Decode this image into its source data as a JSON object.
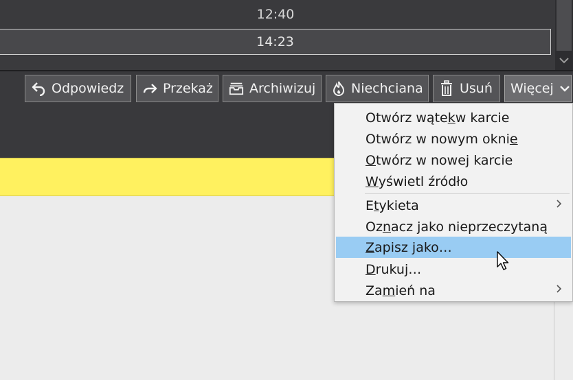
{
  "message_list": {
    "rows": [
      {
        "time": "12:40"
      },
      {
        "time": "14:23"
      }
    ]
  },
  "toolbar": {
    "reply": "Odpowiedz",
    "forward": "Przekaż",
    "archive": "Archiwizuj",
    "junk": "Niechciana",
    "delete": "Usuń",
    "more": "Więcej"
  },
  "menu": {
    "items": [
      {
        "pre": "Otwórz wąte",
        "key": "k",
        "post": " w karcie"
      },
      {
        "pre": "Otwórz w nowym okni",
        "key": "e",
        "post": ""
      },
      {
        "pre": "",
        "key": "O",
        "post": "twórz w nowej karcie"
      },
      {
        "pre": "",
        "key": "W",
        "post": "yświetl źródło"
      },
      {
        "pre": "E",
        "key": "t",
        "post": "ykieta"
      },
      {
        "pre": "Oz",
        "key": "n",
        "post": "acz jako nieprzeczytaną"
      },
      {
        "pre": "",
        "key": "Z",
        "post": "apisz jako…"
      },
      {
        "pre": "",
        "key": "D",
        "post": "rukuj…"
      },
      {
        "pre": "Za",
        "key": "m",
        "post": "ień na"
      }
    ]
  },
  "colors": {
    "banner": "#fff15f",
    "menu_highlight": "#99ccf3",
    "dark_bg": "#39393c"
  }
}
